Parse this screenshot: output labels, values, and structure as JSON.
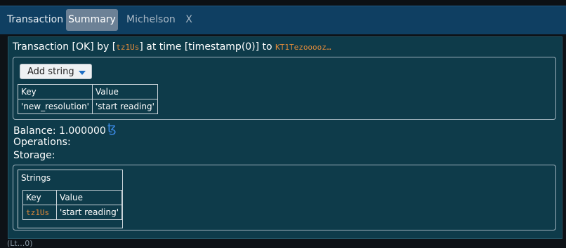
{
  "tabs": [
    {
      "label": "Transaction"
    },
    {
      "label": "Summary"
    },
    {
      "label": "Michelson"
    },
    {
      "label": "X"
    }
  ],
  "transaction": {
    "prefix": "Transaction [OK] by [",
    "sender": "tz1Us",
    "middle": "] at time [timestamp(0)] to",
    "target": "KT1Tezooooz…"
  },
  "parameters": {
    "add_button_label": "Add string",
    "headers": {
      "key": "Key",
      "value": "Value"
    },
    "rows": [
      {
        "key": "'new_resolution'",
        "value": "'start reading'"
      }
    ]
  },
  "summary": {
    "balance_label": "Balance: 1.000000",
    "tez_symbol": "ꜩ",
    "operations_label": "Operations:",
    "storage_label": "Storage:"
  },
  "storage": {
    "title": "Strings",
    "headers": {
      "key": "Key",
      "value": "Value"
    },
    "rows": [
      {
        "key": "tz1Us",
        "value": "'start reading'"
      }
    ]
  },
  "footer_fragment": "(Lt...0)",
  "colors": {
    "tabbar": "#0f3f62",
    "panel": "#0e3b4a",
    "address_orange": "#e08a3a",
    "tez_blue": "#3a88e0"
  }
}
